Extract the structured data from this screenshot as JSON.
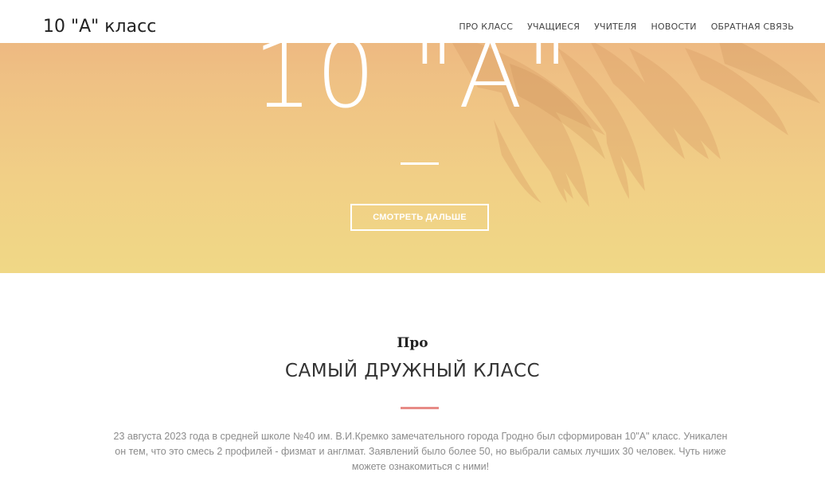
{
  "navbar": {
    "brand": "10 \"А\" класс",
    "items": [
      {
        "label": "ПРО КЛАСС"
      },
      {
        "label": "УЧАЩИЕСЯ"
      },
      {
        "label": "УЧИТЕЛЯ"
      },
      {
        "label": "НОВОСТИ"
      },
      {
        "label": "ОБРАТНАЯ СВЯЗЬ"
      }
    ]
  },
  "hero": {
    "title": "10 \"А\"",
    "button_label": "СМОТРЕТЬ ДАЛЬШЕ",
    "background_image": "eagle-feathers-illustration"
  },
  "about": {
    "pretitle": "Про",
    "title": "САМЫЙ ДРУЖНЫЙ КЛАСС",
    "text": "23 августа 2023 года в средней школе №40 им. В.И.Кремко замечательного города Гродно был сформирован 10\"А\" класс. Уникален он тем, что это смесь 2 профилей - физмат и англмат. Заявлений было более 50, но выбрали самых лучших 30 человек. Чуть ниже можете ознакомиться с ними!"
  },
  "colors": {
    "hero_gradient_top": "#ebb07e",
    "hero_gradient_bottom": "#f0d886",
    "accent_divider": "#e78b86",
    "text_muted": "#8c8c8c"
  }
}
